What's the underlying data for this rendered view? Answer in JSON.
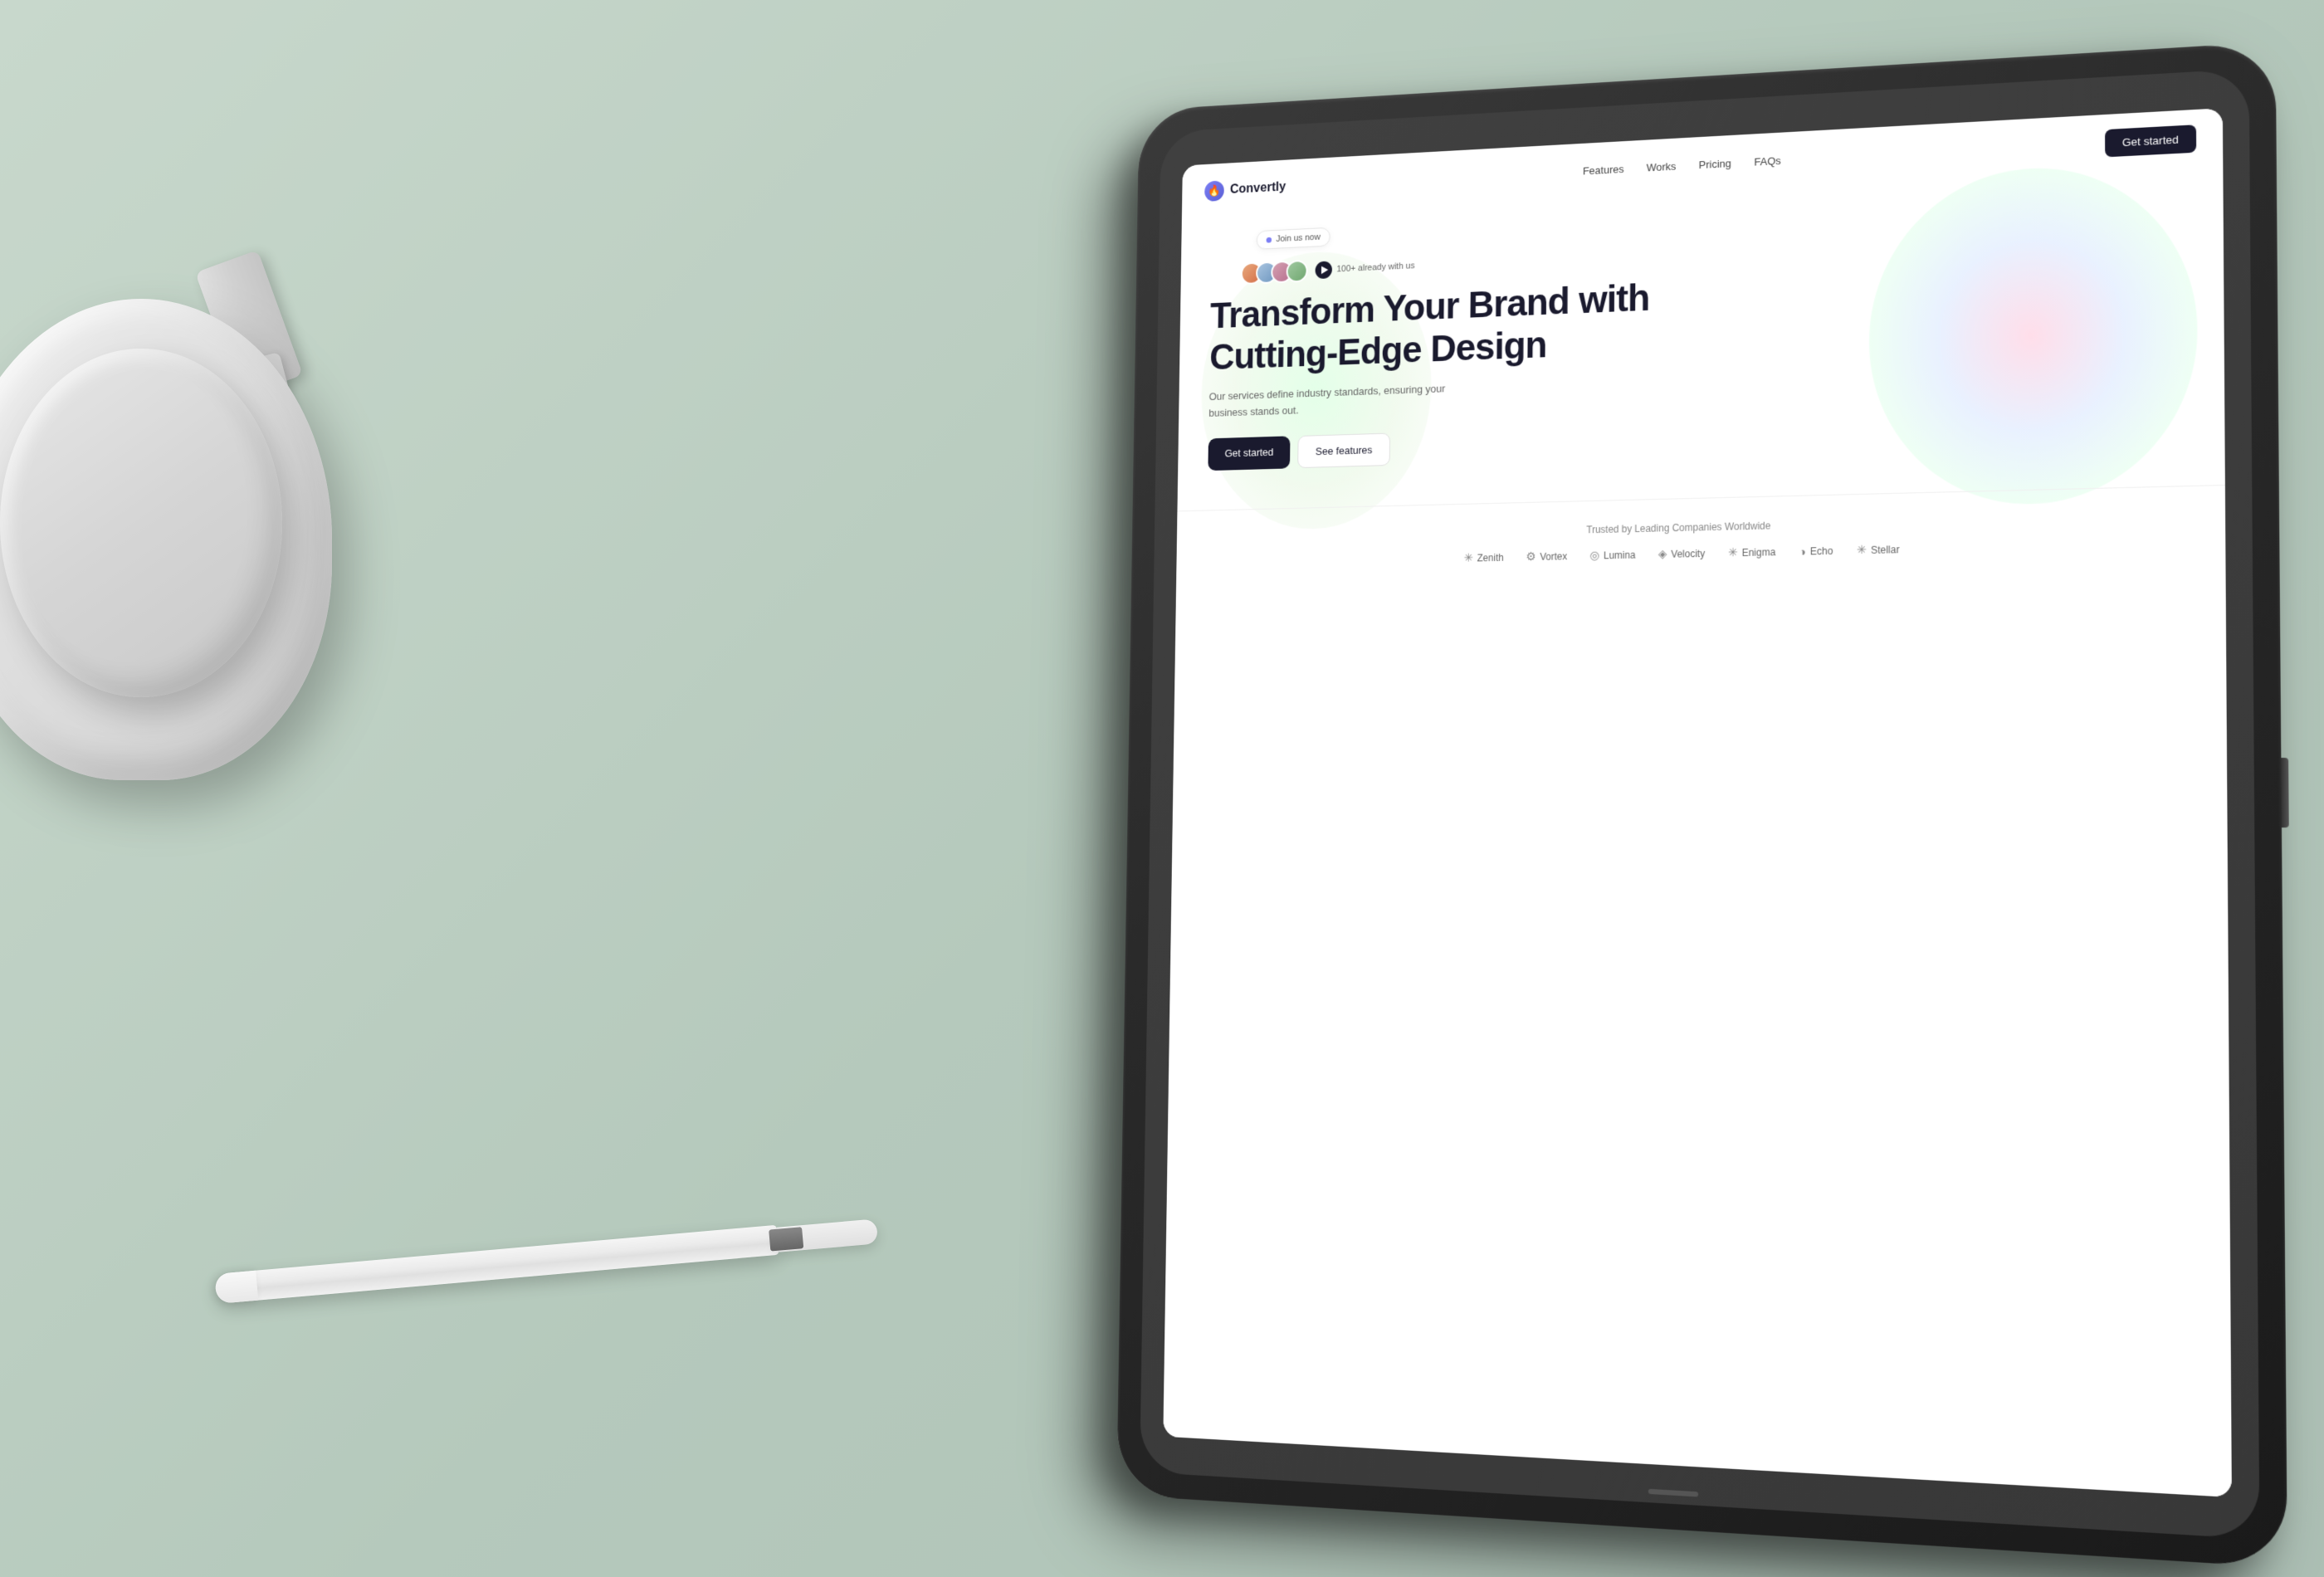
{
  "background": {
    "color": "#b8c9be"
  },
  "nav": {
    "logo_text": "Convertly",
    "links": [
      {
        "label": "Features",
        "id": "features"
      },
      {
        "label": "Works",
        "id": "works"
      },
      {
        "label": "Pricing",
        "id": "pricing"
      },
      {
        "label": "FAQs",
        "id": "faqs"
      }
    ],
    "cta_label": "Get started"
  },
  "hero": {
    "join_badge": "Join us now",
    "avatars_label": "100+ already with us",
    "title_line1": "Transform Your Brand with",
    "title_line2": "Cutting-Edge Design",
    "subtitle": "Our services define industry standards, ensuring your business stands out.",
    "btn_primary": "Get started",
    "btn_secondary": "See features"
  },
  "trusted": {
    "title": "Trusted by Leading Companies Worldwide",
    "companies": [
      {
        "name": "Zenith",
        "icon": "✳"
      },
      {
        "name": "Vortex",
        "icon": "⚙"
      },
      {
        "name": "Lumina",
        "icon": "◎"
      },
      {
        "name": "Velocity",
        "icon": "◈"
      },
      {
        "name": "Enigma",
        "icon": "✳"
      },
      {
        "name": "Echo",
        "icon": "◑"
      },
      {
        "name": "Stellar",
        "icon": "✳"
      }
    ]
  }
}
